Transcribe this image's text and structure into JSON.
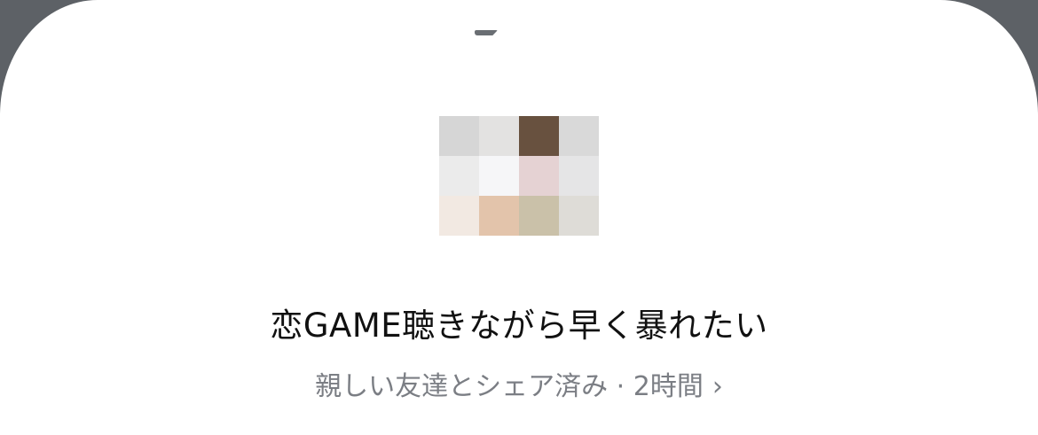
{
  "sheet": {
    "background": "#ffffff"
  },
  "thumbnail": {
    "pixels": [
      "#d6d6d6",
      "#e3e2e1",
      "#68513f",
      "#d9d9d9",
      "#ebebeb",
      "#f6f6f8",
      "#e5d2d3",
      "#e5e5e6",
      "#f2e9e2",
      "#e3c4ab",
      "#cac1a9",
      "#dedcd7"
    ]
  },
  "post": {
    "title": "恋GAME聴きながら早く暴れたい",
    "meta": "親しい友達とシェア済み · 2時間",
    "chevron": "›"
  }
}
